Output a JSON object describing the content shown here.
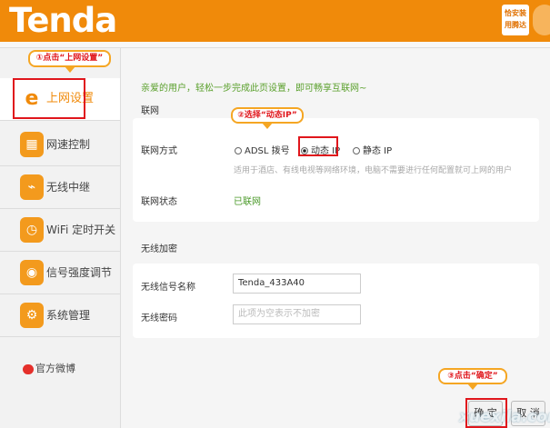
{
  "header": {
    "logo": "Tenda",
    "badge_line1": "恰安装",
    "badge_line2": "用腾达"
  },
  "sidebar": {
    "items": [
      {
        "label": "上网设置",
        "icon": "internet-e-icon",
        "active": true
      },
      {
        "label": "网速控制",
        "icon": "speed-control-icon"
      },
      {
        "label": "无线中继",
        "icon": "wireless-relay-icon"
      },
      {
        "label": "WiFi 定时开关",
        "icon": "wifi-timer-icon"
      },
      {
        "label": "信号强度调节",
        "icon": "signal-strength-icon"
      },
      {
        "label": "系统管理",
        "icon": "system-gear-icon"
      }
    ],
    "weibo": "官方微博"
  },
  "callouts": {
    "step1": "①点击“上网设置”",
    "step2": "②选择“动态IP”",
    "step3": "③点击“确定”"
  },
  "main": {
    "welcome": "亲爱的用户，轻松一步完成此页设置，即可畅享互联网~",
    "network_title": "联网",
    "method_label": "联网方式",
    "options": [
      "ADSL 拨号",
      "动态 IP",
      "静态 IP"
    ],
    "selected_option": "动态 IP",
    "hint": "适用于酒店、有线电视等网络环境，电脑不需要进行任何配置就可上网的用户",
    "status_label": "联网状态",
    "status_value": "已联网",
    "wireless_title": "无线加密",
    "ssid_label": "无线信号名称",
    "ssid_value": "Tenda_433A40",
    "password_label": "无线密码",
    "password_placeholder": "此项为空表示不加密"
  },
  "buttons": {
    "ok": "确 定",
    "cancel": "取 消"
  },
  "watermark": "xuexila.com"
}
